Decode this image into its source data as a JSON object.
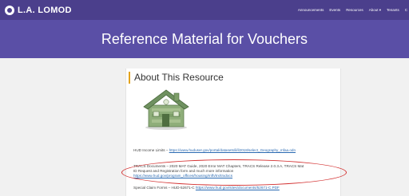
{
  "nav": {
    "brand": "L.A. LOMOD",
    "links": [
      "Announcements",
      "Events",
      "Resources",
      "About ▾",
      "Tenants",
      "C"
    ]
  },
  "hero": {
    "title": "Reference Material for Vouchers"
  },
  "section": {
    "heading": "About This Resource",
    "items": {
      "income": {
        "label": "HUD Income Limits – ",
        "link": "https://www.huduser.gov/portal/datasets/il/il2018/select_Geography_mfaa.odn"
      },
      "tracs": {
        "line1": "TRACS Documents – 2020 MAT Guide, 2020 Error MAT Chapters, TRACS Release 2.0.3.A, TRACS Mat",
        "line2": "ID Request and Registration form and much more information",
        "link": "https://www.hud.gov/program_offices/housing/mfh/trx/trxdocs"
      },
      "special": {
        "label": "Special Claim Forms – HUD-52671-C ",
        "link": "https://www.hud.gov/sites/documents/52671-C.PDF"
      }
    }
  },
  "colors": {
    "navbar": "#4b3f8c",
    "hero": "#5a4fa6",
    "accent": "#e3a31c",
    "annotation": "#d33030"
  }
}
